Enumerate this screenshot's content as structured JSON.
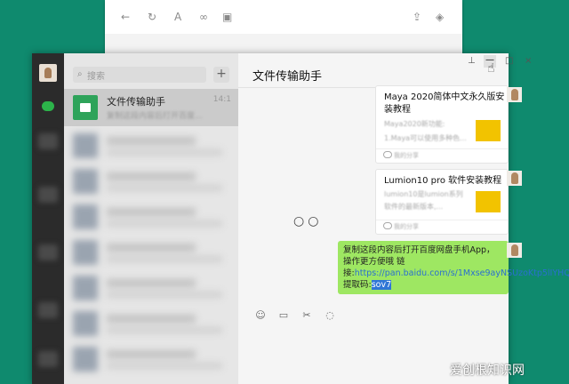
{
  "browser": {
    "icons": [
      "back-icon",
      "refresh-icon",
      "text-icon",
      "link-icon",
      "window-icon",
      "share-icon",
      "cube-icon"
    ]
  },
  "sidebar": {
    "search_placeholder": "搜索",
    "add_label": "+",
    "active_chat": {
      "name": "文件传输助手",
      "time": "14:1",
      "preview": "复制这段内容后打开百度..."
    }
  },
  "chat": {
    "title": "文件传输助手",
    "window_controls": {
      "pin": "⊥",
      "min": "—",
      "max": "□",
      "close": "×"
    },
    "cards": [
      {
        "title": "Maya 2020简体中文永久版安装教程",
        "desc1": "Maya2020新功能:",
        "desc2": "1.Maya可以使用多种色...",
        "footer": "我的分享"
      },
      {
        "title": "Lumion10 pro 软件安装教程",
        "desc1": "lumion10是lumion系列",
        "desc2": "软件的最新版本,...",
        "footer": "我的分享"
      }
    ],
    "loading": "○○",
    "message": {
      "text_before": "复制这段内容后打开百度网盘手机App，操作更方便哦 链接:",
      "link": "https://pan.baidu.com/s/1Mxse9ayNSUzoKtp5lIYHQQ",
      "text_after": " 提取码:",
      "code": "sov7"
    },
    "toolbar": [
      "☺",
      "▭",
      "✂",
      "◌"
    ]
  },
  "watermark": "爱创根知识网",
  "colors": {
    "accent": "#2ea35a",
    "bubble": "#9ee762",
    "desktop": "#0f8a6e",
    "selection": "#2f76d6"
  }
}
